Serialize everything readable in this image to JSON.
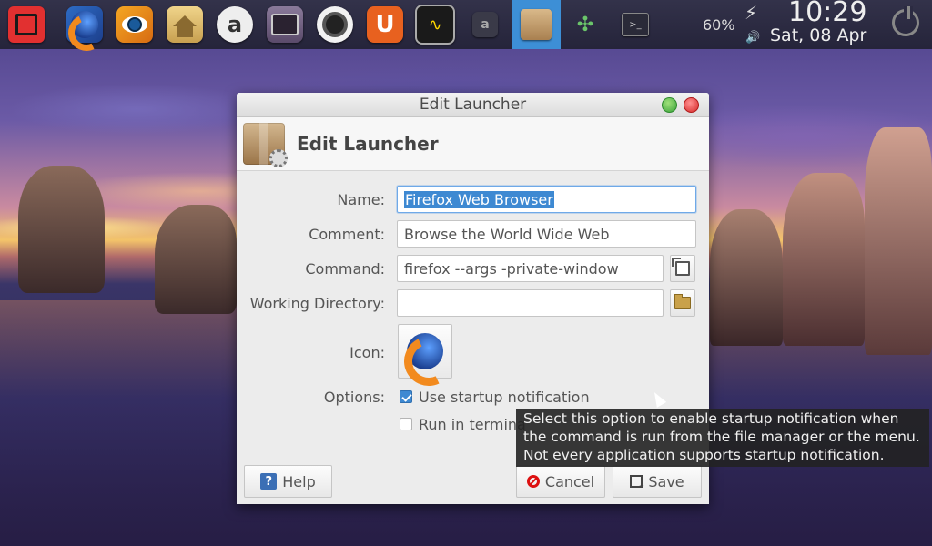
{
  "panel": {
    "launchers": [
      {
        "name": "shutdown-launcher",
        "icon": "power-square-icon"
      },
      {
        "name": "firefox-launcher",
        "icon": "firefox-icon"
      },
      {
        "name": "eye-app-launcher",
        "icon": "eye-icon"
      },
      {
        "name": "home-folder-launcher",
        "icon": "home-folder-icon"
      },
      {
        "name": "a-app-launcher",
        "icon": "a-letter-icon"
      },
      {
        "name": "radio-app-launcher",
        "icon": "radio-icon"
      },
      {
        "name": "camera-app-launcher",
        "icon": "camera-lens-icon"
      },
      {
        "name": "u-app-launcher",
        "icon": "u-letter-icon"
      },
      {
        "name": "system-monitor-launcher",
        "icon": "system-monitor-icon"
      },
      {
        "name": "a-app-small-launcher",
        "icon": "a-letter-small-icon"
      },
      {
        "name": "edit-launcher-taskitem",
        "icon": "package-box-icon"
      },
      {
        "name": "puzzle-app-launcher",
        "icon": "puzzle-icon"
      },
      {
        "name": "terminal-launcher",
        "icon": "terminal-icon"
      }
    ],
    "battery": "60%",
    "time": "10:29",
    "date": "Sat, 08 Apr"
  },
  "dialog": {
    "window_title": "Edit Launcher",
    "header_title": "Edit Launcher",
    "labels": {
      "name": "Name:",
      "comment": "Comment:",
      "command": "Command:",
      "working_directory": "Working Directory:",
      "icon": "Icon:",
      "options": "Options:"
    },
    "fields": {
      "name": "Firefox Web Browser",
      "comment": "Browse the World Wide Web",
      "command": "firefox --args -private-window",
      "working_directory": ""
    },
    "options": {
      "startup_notification": {
        "label": "Use startup notification",
        "checked": true
      },
      "run_in_terminal": {
        "label": "Run in termina",
        "checked": false
      }
    },
    "buttons": {
      "help": "Help",
      "cancel": "Cancel",
      "save": "Save"
    }
  },
  "tooltip": {
    "line1": "Select this option to enable startup notification when",
    "line2": "the command is run from the file manager or the menu.",
    "line3": "Not every application supports startup notification."
  }
}
